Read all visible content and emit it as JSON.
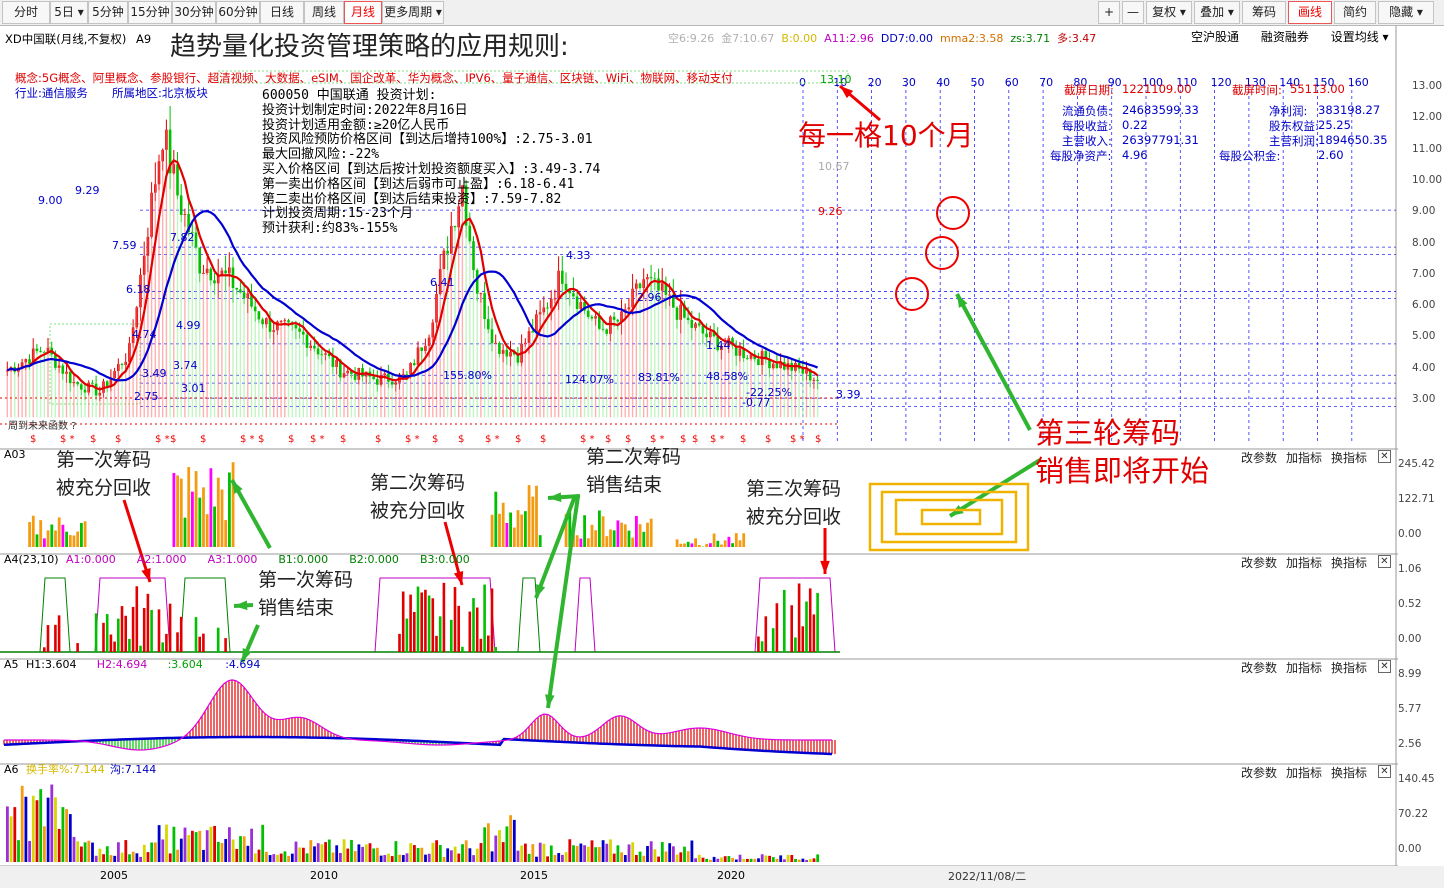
{
  "toolbar": {
    "periods": [
      "分时",
      "5日",
      "5分钟",
      "15分钟",
      "30分钟",
      "60分钟",
      "日线",
      "周线",
      "月线",
      "更多周期"
    ],
    "active_period": "月线",
    "right": [
      "+",
      "—",
      "复权",
      "叠加",
      "筹码",
      "画线",
      "简约",
      "隐藏"
    ]
  },
  "header": {
    "stock": "XD中国联",
    "period_note": "(月线,不复权)",
    "indicator": "A9",
    "big_title": "趋势量化投资管理策略的应用规则:",
    "params": [
      {
        "text": "空6:9.26",
        "color": "#b0b0b0"
      },
      {
        "text": "金7:10.67",
        "color": "#b0b0b0"
      },
      {
        "text": "B:0.00",
        "color": "#d6b800"
      },
      {
        "text": "A11:2.96",
        "color": "#c000c0"
      },
      {
        "text": "DD7:0.00",
        "color": "#0000c0"
      },
      {
        "text": "mma2:3.58",
        "color": "#d07000"
      },
      {
        "text": "zs:3.71",
        "color": "#008000"
      },
      {
        "text": "多:3.47",
        "color": "#c00000"
      }
    ],
    "links": [
      "空沪股通",
      "融资融券",
      "设置均线"
    ]
  },
  "concepts": "概念:5G概念、阿里概念、参股银行、超清视频、大数据、eSIM、国企改革、华为概念、IPV6、量子通信、区块链、WiFi、物联网、移动支付",
  "industry": "行业:通信服务",
  "region": "所属地区:北京板块",
  "plan_lines": [
    "600050 中国联通 投资计划:",
    "投资计划制定时间:2022年8月16日",
    "投资计划适用金额:≥20亿人民币",
    "投资风险预防价格区间【到达后增持100%】:2.75-3.01",
    "最大回撤风险:-22%",
    "买入价格区间【到达后按计划投资额度买入】:3.49-3.74",
    "第一卖出价格区间【到达后弱市可止盈】:6.18-6.41",
    "第二卖出价格区间【到达后结束投资】:7.59-7.82",
    "计划投资周期:15-23个月",
    "预计获利:约83%-155%"
  ],
  "price_axis": [
    "13.00",
    "12.00",
    "11.00",
    "10.00",
    "9.00",
    "8.00",
    "7.00",
    "6.00",
    "5.00",
    "4.00",
    "3.00"
  ],
  "price_labels": [
    "9.29",
    "9.00",
    "7.82",
    "7.59",
    "6.18",
    "6.41",
    "4.74",
    "4.99",
    "3.49",
    "3.74",
    "3.01",
    "2.75",
    "4.33",
    "2.96",
    "1.44",
    "3.39",
    "10.67",
    "9.26",
    "13.10",
    "-0.77"
  ],
  "pct_labels": [
    "155.80%",
    "124.07%",
    "83.81%",
    "48.58%",
    "-22.25%"
  ],
  "month_scale": [
    "0",
    "10",
    "20",
    "30",
    "40",
    "50",
    "60",
    "70",
    "80",
    "90",
    "100",
    "110",
    "120",
    "130",
    "140",
    "150",
    "160"
  ],
  "financials": {
    "date_label": "截屏日期:",
    "date_value": "1221109.00",
    "time_label": "截屏时间:",
    "time_value": "55113.00",
    "left": [
      {
        "label": "流通负债:",
        "value": "24683599.33"
      },
      {
        "label": "每股收益:",
        "value": "0.22"
      },
      {
        "label": "主营收入:",
        "value": "26397791.31"
      },
      {
        "label": "每股净资产:",
        "value": "4.96"
      }
    ],
    "right": [
      {
        "label": "净利润:",
        "value": "383198.27"
      },
      {
        "label": "股东权益:",
        "value": "25.25"
      },
      {
        "label": "主营利润:",
        "value": "1894650.35"
      },
      {
        "label": "每股公积金:",
        "value": "2.60"
      }
    ]
  },
  "future_func": "周到未来函数 ?",
  "panels": {
    "a03": {
      "title": "A03",
      "ticks": [
        "245.42",
        "122.71",
        "0.00"
      ]
    },
    "a4": {
      "title": "A4(23,10)",
      "vals": [
        {
          "t": "A1:0.000",
          "c": "#c000c0"
        },
        {
          "t": "A2:1.000",
          "c": "#c000c0"
        },
        {
          "t": "A3:1.000",
          "c": "#c000c0"
        },
        {
          "t": "B1:0.000",
          "c": "#008000"
        },
        {
          "t": "B2:0.000",
          "c": "#008000"
        },
        {
          "t": "B3:0.000",
          "c": "#008000"
        }
      ],
      "ticks": [
        "1.06",
        "0.52",
        "0.00"
      ]
    },
    "a5": {
      "title": "A5",
      "vals": [
        {
          "t": "H1:3.604",
          "c": "#000"
        },
        {
          "t": "H2:4.694",
          "c": "#c000c0"
        },
        {
          "t": ":3.604",
          "c": "#00a000"
        },
        {
          "t": ":4.694",
          "c": "#0000c0"
        }
      ],
      "ticks": [
        "8.99",
        "5.77",
        "2.56"
      ]
    },
    "a6": {
      "title": "A6",
      "vals": [
        {
          "t": "换手率%:7.144",
          "c": "#d6b800"
        },
        {
          "t": "沟:7.144",
          "c": "#0000c0"
        }
      ],
      "ticks": [
        "140.45",
        "70.22",
        "0.00"
      ]
    },
    "buttons": [
      "改参数",
      "加指标",
      "换指标"
    ]
  },
  "years": [
    "2005",
    "2010",
    "2015",
    "2020"
  ],
  "status_date": "2022/11/08/二",
  "annotations": {
    "month": "每一格10个月",
    "third": [
      "第三轮筹码",
      "销售即将开始"
    ],
    "first_recover": [
      "第一次筹码",
      "被充分回收"
    ],
    "second_recover": [
      "第二次筹码",
      "被充分回收"
    ],
    "second_end": [
      "第二次筹码",
      "销售结束"
    ],
    "third_recover": [
      "第三次筹码",
      "被充分回收"
    ],
    "first_end": [
      "第一次筹码",
      "销售结束"
    ]
  },
  "colors": {
    "up": "#e00000",
    "down": "#00c000",
    "ma_fast": "#e00000",
    "ma_slow": "#0000d0",
    "grid": "#2a2aff",
    "annot": "#e00000",
    "arrow": "#2fb52f"
  }
}
